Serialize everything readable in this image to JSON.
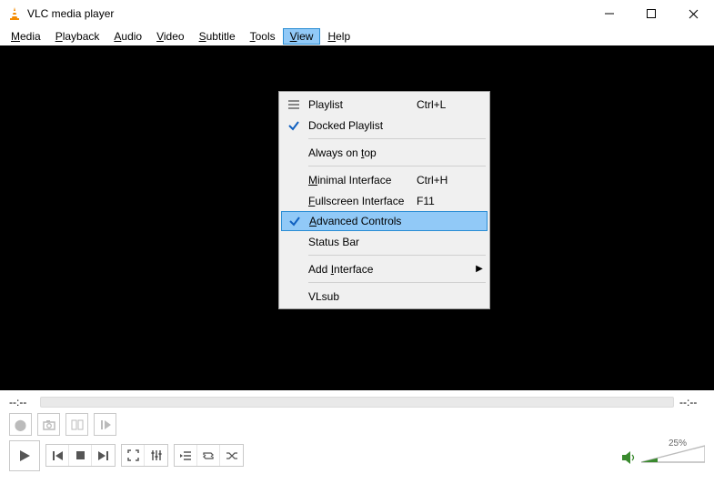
{
  "title": "VLC media player",
  "menubar": [
    "Media",
    "Playback",
    "Audio",
    "Video",
    "Subtitle",
    "Tools",
    "View",
    "Help"
  ],
  "menubar_hotkeys": [
    "M",
    "P",
    "A",
    "V",
    "S",
    "T",
    "V",
    "H"
  ],
  "open_menu_index": 6,
  "view_menu": {
    "items": [
      {
        "type": "item",
        "label": "Playlist",
        "shortcut": "Ctrl+L",
        "icon": "list",
        "u": null
      },
      {
        "type": "item",
        "label": "Docked Playlist",
        "shortcut": "",
        "icon": "check",
        "u": null
      },
      {
        "type": "sep"
      },
      {
        "type": "item",
        "label": "Always on top",
        "shortcut": "",
        "icon": "",
        "u": "t"
      },
      {
        "type": "sep"
      },
      {
        "type": "item",
        "label": "Minimal Interface",
        "shortcut": "Ctrl+H",
        "icon": "",
        "u": "M"
      },
      {
        "type": "item",
        "label": "Fullscreen Interface",
        "shortcut": "F11",
        "icon": "",
        "u": "F"
      },
      {
        "type": "item",
        "label": "Advanced Controls",
        "shortcut": "",
        "icon": "check",
        "u": "A",
        "highlight": true
      },
      {
        "type": "item",
        "label": "Status Bar",
        "shortcut": "",
        "icon": "",
        "u": null
      },
      {
        "type": "sep"
      },
      {
        "type": "item",
        "label": "Add Interface",
        "shortcut": "",
        "icon": "",
        "submenu": true,
        "u": "I"
      },
      {
        "type": "sep"
      },
      {
        "type": "item",
        "label": "VLsub",
        "shortcut": "",
        "icon": "",
        "u": null
      }
    ]
  },
  "time": {
    "current": "--:--",
    "total": "--:--"
  },
  "volume": {
    "percent": "25%"
  }
}
